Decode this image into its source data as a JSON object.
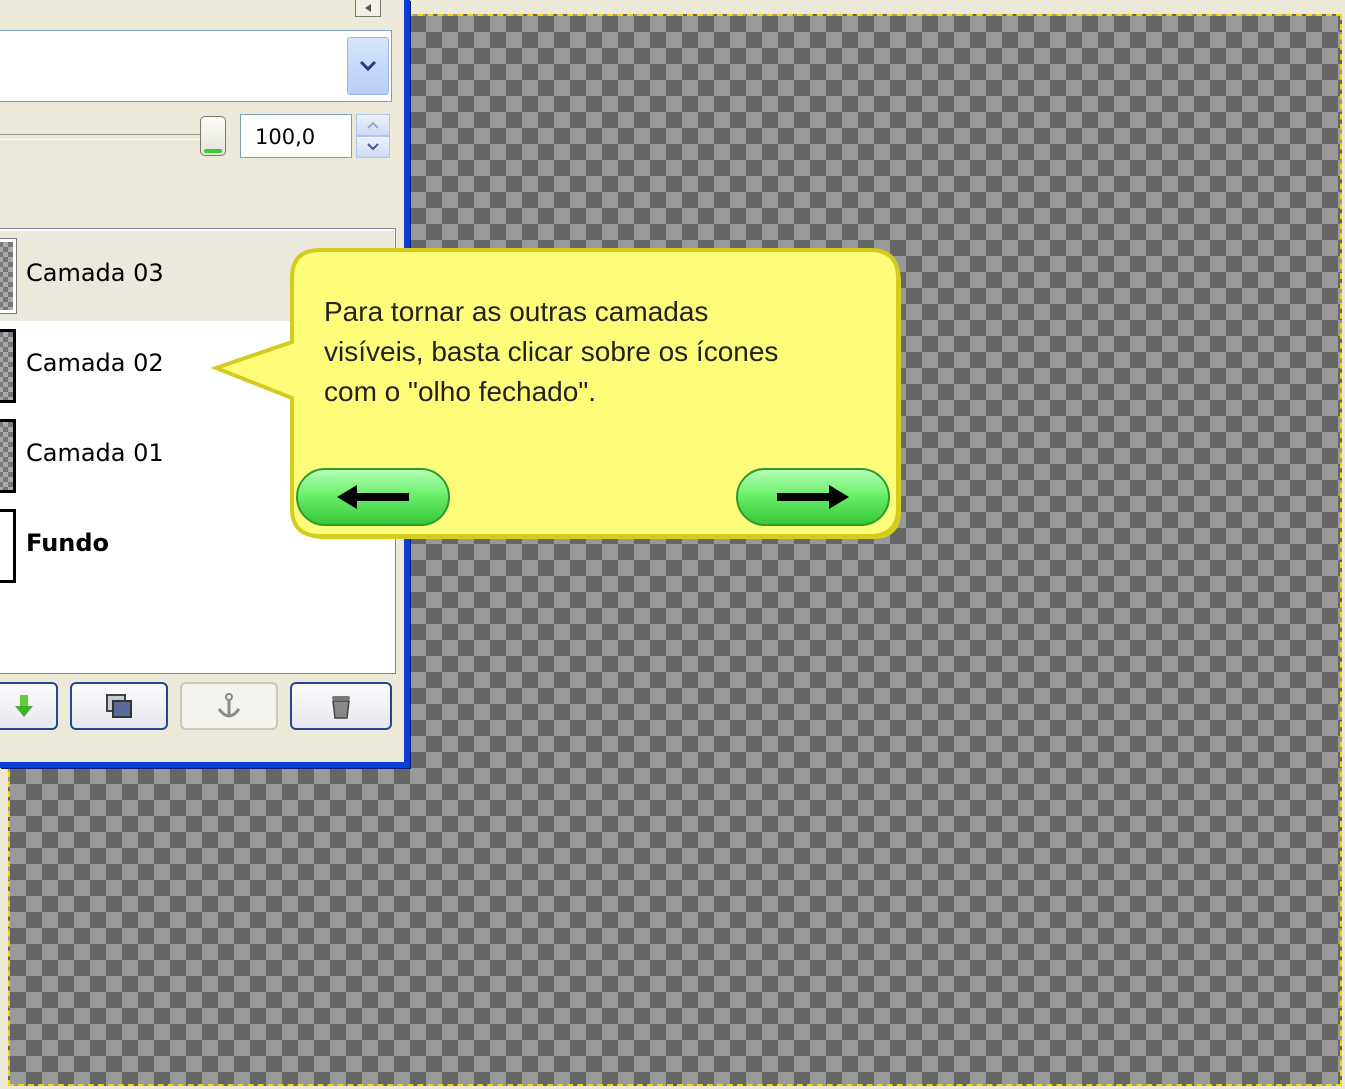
{
  "dialog": {
    "mode_combo": {
      "value": ""
    },
    "opacity": {
      "value": "100,0"
    },
    "layers": [
      {
        "name": "Camada 03",
        "selected": true,
        "bold": false
      },
      {
        "name": "Camada 02",
        "selected": false,
        "bold": false
      },
      {
        "name": "Camada 01",
        "selected": false,
        "bold": false
      },
      {
        "name": "Fundo",
        "selected": false,
        "bold": true
      }
    ],
    "buttons": [
      {
        "icon": "lower-layer-icon"
      },
      {
        "icon": "duplicate-layer-icon"
      },
      {
        "icon": "anchor-layer-icon",
        "disabled": true
      },
      {
        "icon": "delete-layer-icon"
      }
    ]
  },
  "callout": {
    "text": "Para tornar as outras camadas visíveis, basta clicar sobre os ícones com o \"olho fechado\".",
    "prev_icon": "arrow-left-icon",
    "next_icon": "arrow-right-icon"
  },
  "colors": {
    "window_border": "#0a3cd8",
    "callout_fill": "#fdfd7a",
    "callout_border": "#d8d020",
    "nav_green": "#58e058"
  }
}
